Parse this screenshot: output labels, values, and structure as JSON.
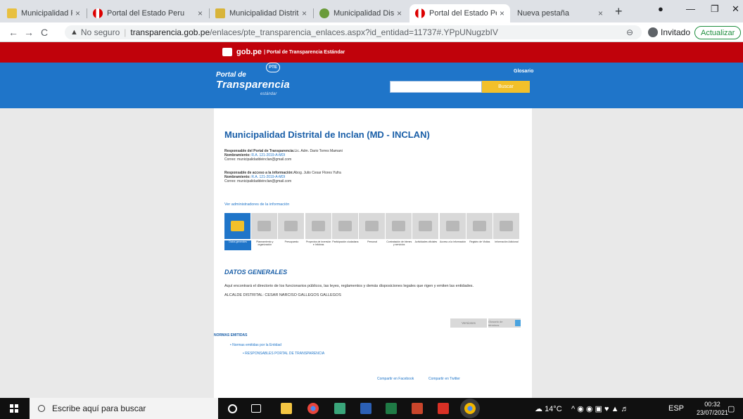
{
  "browser": {
    "tabs": [
      {
        "title": "Municipalidad Provinc",
        "active": false
      },
      {
        "title": "Portal del Estado Peru",
        "active": false
      },
      {
        "title": "Municipalidad Distrita",
        "active": false
      },
      {
        "title": "Municipalidad Distrita",
        "active": false
      },
      {
        "title": "Portal del Estado Peru",
        "active": true
      },
      {
        "title": "Nueva pestaña",
        "active": false
      }
    ],
    "new_tab": "+",
    "url_security": "No seguro",
    "url_host": "transparencia.gob.pe",
    "url_path": "/enlaces/pte_transparencia_enlaces.aspx?id_entidad=11737#.YPpUNugzbIV",
    "profile": "Invitado",
    "update_button": "Actualizar"
  },
  "site": {
    "gob_brand": "gob.pe",
    "gob_sub": "| Portal de Transparencia Estándar",
    "logo_line1": "Portal de",
    "logo_line2": "Transparencia",
    "logo_line3": "estándar",
    "pte_badge": "PTE",
    "glosario": "Glosario",
    "search_button": "Buscar"
  },
  "entity": {
    "name": "Municipalidad Distrital de Inclan (MD - INCLAN)",
    "resp_portal_label": "Responsable del Portal de Transparencia:",
    "resp_portal_name": "Lic. Adm. Dario Torres Mamani",
    "resp_portal_appt_label": "Nombramiento:",
    "resp_portal_appt": "R.A. 121-2019-A-MDI",
    "resp_portal_mail": "Correo: municipalidaddeinclan@gmail.com",
    "resp_access_label": "Responsable de acceso a la información:",
    "resp_access_name": "Abog. Julio Cesar Flores Yufra",
    "resp_access_appt_label": "Nombramiento:",
    "resp_access_appt": "R.A. 121-2019-A-MDI",
    "resp_access_mail": "Correo: municipalidaddeinclan@gmail.com",
    "ver_admin": "Ver administradores de la información"
  },
  "categories": [
    {
      "label": "Datos generales",
      "selected": true,
      "icon": "building-icon"
    },
    {
      "label": "Planeamiento y organización",
      "selected": false,
      "icon": "org-chart-icon"
    },
    {
      "label": "Presupuesto",
      "selected": false,
      "icon": "money-icon"
    },
    {
      "label": "Proyectos de inversión e Infobras",
      "selected": false,
      "icon": "worker-icon"
    },
    {
      "label": "Participación ciudadana",
      "selected": false,
      "icon": "hand-icon"
    },
    {
      "label": "Personal",
      "selected": false,
      "icon": "people-icon"
    },
    {
      "label": "Contratación de bienes y servicios",
      "selected": false,
      "icon": "pen-icon"
    },
    {
      "label": "Actividades oficiales",
      "selected": false,
      "icon": "calendar-icon"
    },
    {
      "label": "Acceso a la información",
      "selected": false,
      "icon": "document-icon"
    },
    {
      "label": "Registro de Visitas",
      "selected": false,
      "icon": "visitor-icon"
    },
    {
      "label": "Información Adicional",
      "selected": false,
      "icon": "plus-box-icon"
    }
  ],
  "content": {
    "title": "DATOS GENERALES",
    "description": "Aquí encontrará el directorio de los funcionarios públicos, las leyes, reglamentos y demás disposiciones legales que rigen y emiten las entidades.",
    "mayor": "ALCALDE DISTRITAL: CESAR NARCISO GALLEGOS GALLEGOS",
    "versions_button": "Versiones",
    "glossary_button": "Glosario de términos",
    "normas_title": "NORMAS EMITIDAS",
    "normas_item": "Normas emitidas por la Entidad",
    "normas_subitem": "RESPONSABLES PORTAL DE TRANSPARENCIA",
    "share_facebook": "Compartir en Facebook",
    "share_twitter": "Compartir en Twitter"
  },
  "taskbar": {
    "search_placeholder": "Escribe aquí para buscar",
    "weather": "14°C",
    "language": "ESP",
    "time": "00:32",
    "date": "23/07/2021"
  }
}
